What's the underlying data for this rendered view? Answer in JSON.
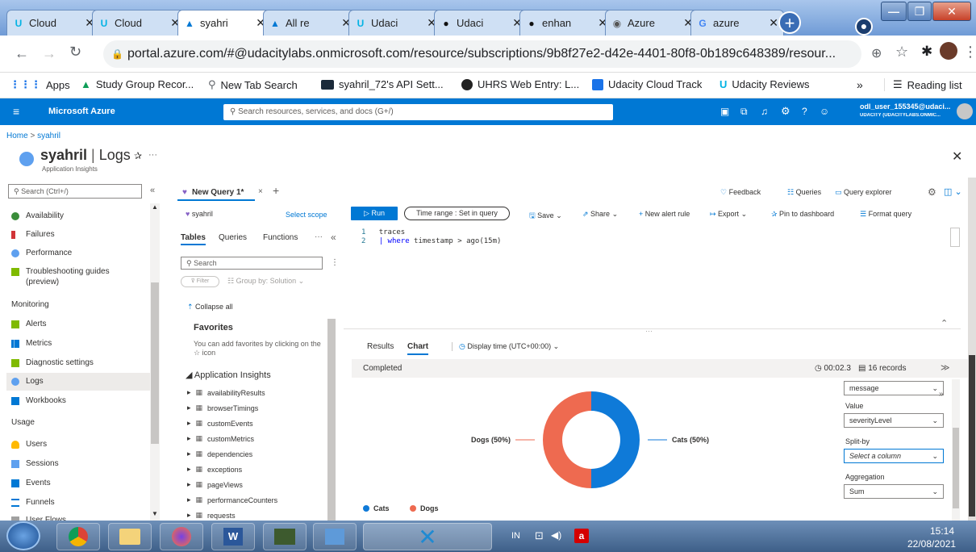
{
  "browser": {
    "tabs": [
      {
        "label": "Cloud",
        "icon": "udacity-icon"
      },
      {
        "label": "Cloud",
        "icon": "udacity-icon"
      },
      {
        "label": "syahri",
        "icon": "azure-icon"
      },
      {
        "label": "All re",
        "icon": "azure-icon"
      },
      {
        "label": "Udaci",
        "icon": "udacity-icon"
      },
      {
        "label": "Udaci",
        "icon": "github-icon"
      },
      {
        "label": "enhan",
        "icon": "github-icon"
      },
      {
        "label": "Azure",
        "icon": "globe-icon"
      },
      {
        "label": "azure",
        "icon": "google-icon"
      }
    ],
    "url": "portal.azure.com/#@udacitylabs.onmicrosoft.com/resource/subscriptions/9b8f27e2-d42e-4401-80f8-0b189c648389/resour...",
    "bookmarks": [
      "Apps",
      "Study Group Recor...",
      "New Tab Search",
      "syahril_72's API Sett...",
      "UHRS Web Entry: L...",
      "Udacity Cloud Track",
      "Udacity Reviews"
    ],
    "more_bookmarks": "»",
    "reading_list": "Reading list"
  },
  "azure": {
    "brand": "Microsoft Azure",
    "search_placeholder": "Search resources, services, and docs (G+/)",
    "user": "odl_user_155345@udaci...",
    "tenant": "UDACITY (UDACITYLABS.ONMIC...",
    "breadcrumb": [
      "Home",
      "syahril"
    ],
    "resource_name": "syahril",
    "blade_title": "Logs",
    "resource_type": "Application Insights"
  },
  "left_nav": {
    "search": "Search (Ctrl+/)",
    "items_top": [
      "Availability",
      "Failures",
      "Performance",
      "Troubleshooting guides",
      "(preview)"
    ],
    "monitoring_header": "Monitoring",
    "monitoring": [
      "Alerts",
      "Metrics",
      "Diagnostic settings",
      "Logs",
      "Workbooks"
    ],
    "usage_header": "Usage",
    "usage": [
      "Users",
      "Sessions",
      "Events",
      "Funnels",
      "User Flows"
    ]
  },
  "query": {
    "tab": "New Query 1*",
    "scope": "syahril",
    "select_scope": "Select scope",
    "run": "Run",
    "time_range": "Time range : Set in query",
    "toolbar": [
      "Save",
      "Share",
      "New alert rule",
      "Export",
      "Pin to dashboard",
      "Format query"
    ],
    "top_right": [
      "Feedback",
      "Queries",
      "Query explorer"
    ],
    "side_tabs": [
      "Tables",
      "Queries",
      "Functions"
    ],
    "side_search": "Search",
    "filter": "Filter",
    "group_by": "Group by: Solution",
    "collapse_all": "Collapse all",
    "favorites": "Favorites",
    "favorites_hint": "You can add favorites by clicking on the ☆ icon",
    "app_insights": "Application Insights",
    "tables": [
      "availabilityResults",
      "browserTimings",
      "customEvents",
      "customMetrics",
      "dependencies",
      "exceptions",
      "pageViews",
      "performanceCounters",
      "requests"
    ],
    "code_line1_num": "1",
    "code_line1": "traces",
    "code_line2_num": "2",
    "code_line2_kw": "| where",
    "code_line2_rest": " timestamp > ago(15m)"
  },
  "results": {
    "tabs": [
      "Results",
      "Chart"
    ],
    "display_time": "Display time (UTC+00:00)",
    "status": "Completed",
    "elapsed": "00:02.3",
    "records": "16 records",
    "side": {
      "message": "message",
      "value_label": "Value",
      "value": "severityLevel",
      "split_label": "Split-by",
      "split": "Select a column",
      "agg_label": "Aggregation",
      "agg": "Sum"
    }
  },
  "chart_data": {
    "type": "pie",
    "donut": true,
    "categories": [
      "Cats",
      "Dogs"
    ],
    "values": [
      50,
      50
    ],
    "labels": [
      "Cats (50%)",
      "Dogs (50%)"
    ],
    "colors": [
      "#0f7ad8",
      "#ee6a50"
    ],
    "legend": "bottom-left"
  },
  "taskbar": {
    "lang": "IN",
    "time": "15:14",
    "date": "22/08/2021"
  },
  "colors": {
    "azure_blue": "#0078d4",
    "cats": "#0f7ad8",
    "dogs": "#ee6a50"
  }
}
